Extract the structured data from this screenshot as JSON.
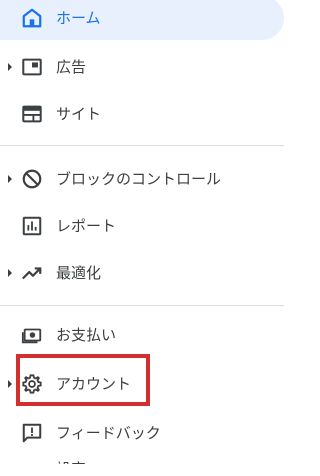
{
  "nav": {
    "home": {
      "label": "ホーム",
      "icon": "home-icon"
    },
    "ads": {
      "label": "広告",
      "icon": "ads-icon"
    },
    "sites": {
      "label": "サイト",
      "icon": "sites-icon"
    },
    "blocking": {
      "label": "ブロックのコントロール",
      "icon": "block-icon"
    },
    "reports": {
      "label": "レポート",
      "icon": "reports-icon"
    },
    "optimization": {
      "label": "最適化",
      "icon": "trending-up-icon"
    },
    "payments": {
      "label": "お支払い",
      "icon": "payments-icon"
    },
    "account": {
      "label": "アカウント",
      "icon": "gear-icon"
    },
    "feedback": {
      "label": "フィードバック",
      "icon": "feedback-icon"
    },
    "next_partial": {
      "label": "設定"
    }
  },
  "colors": {
    "active_bg": "#e8f0fe",
    "active_text": "#1a73e8",
    "highlight_box": "#d32f2f"
  }
}
